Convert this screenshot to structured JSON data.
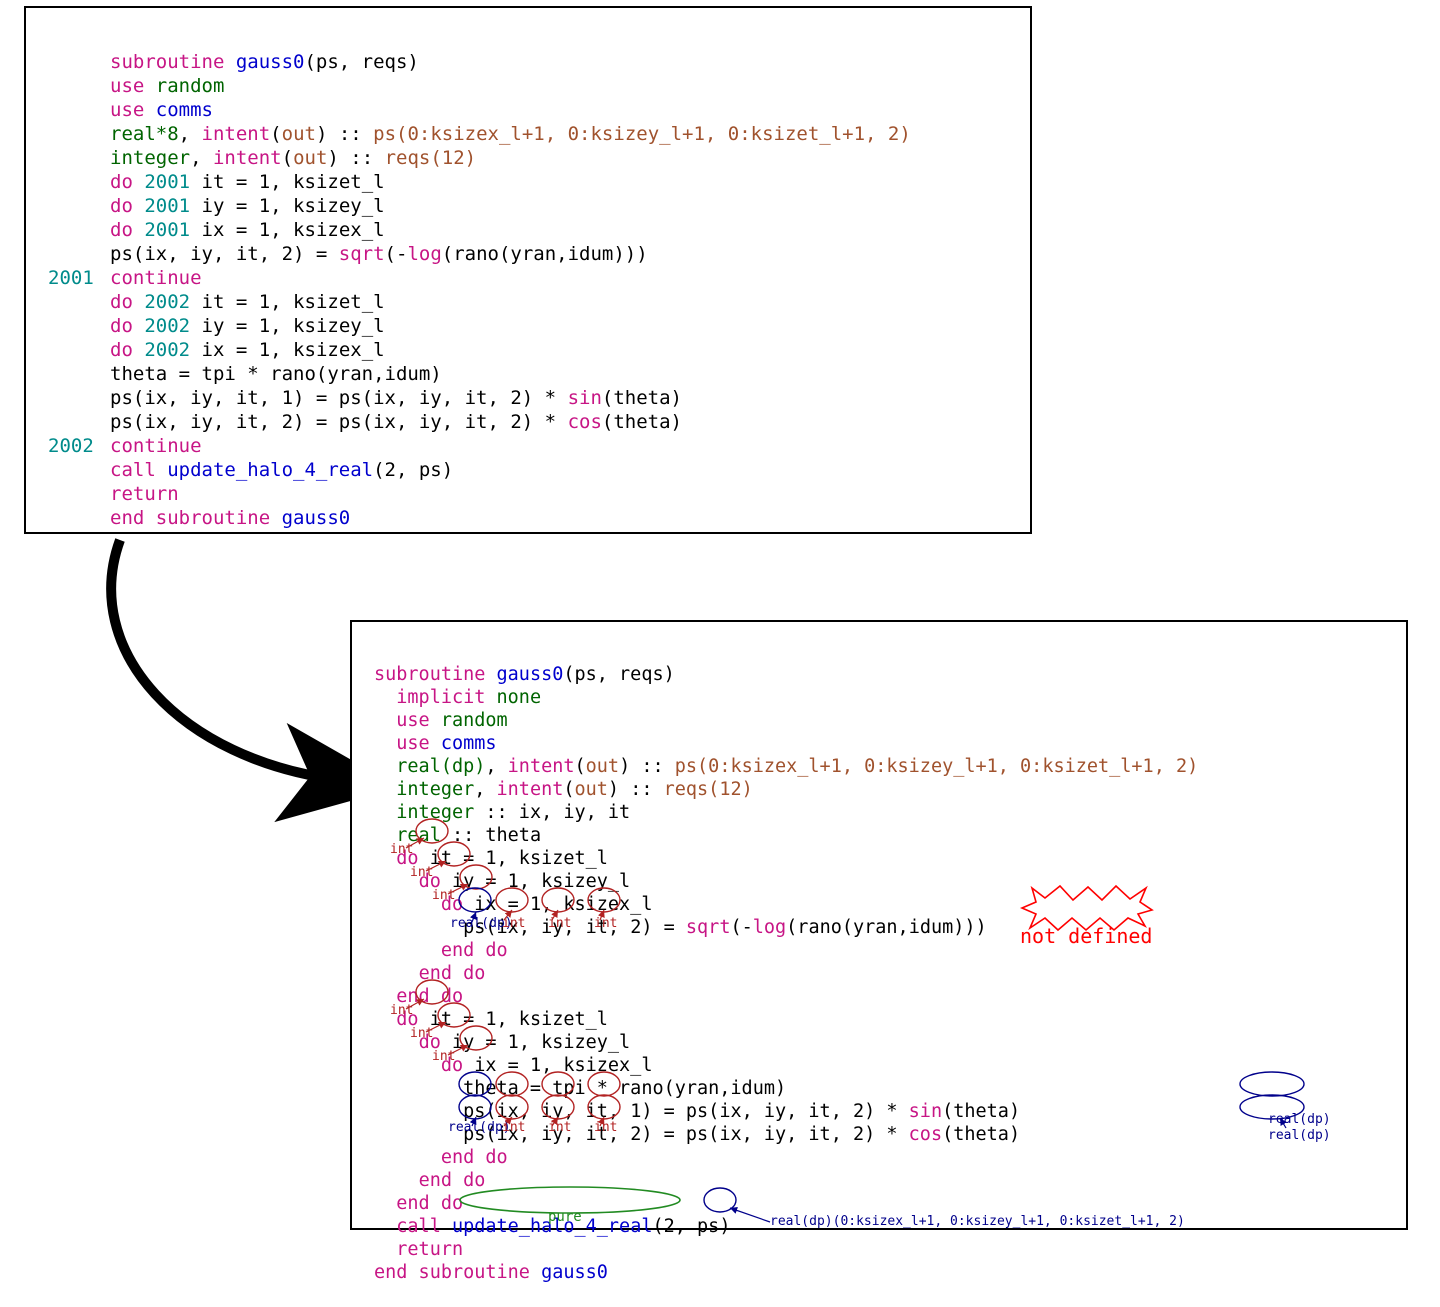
{
  "top": {
    "l1": "subroutine",
    "l1b": "gauss0",
    "l1c": "(ps, reqs)",
    "l2": "use",
    "l2b": "random",
    "l3": "use",
    "l3b": "comms",
    "l4a": "real*8",
    "l4b": ", ",
    "l4c": "intent",
    "l4d": "(",
    "l4e": "out",
    "l4f": ") :: ",
    "l4g": "ps(0:ksizex_l+1, 0:ksizey_l+1, 0:ksizet_l+1, 2)",
    "l5a": "integer",
    "l5b": ", ",
    "l5c": "intent",
    "l5d": "(",
    "l5e": "out",
    "l5f": ") :: ",
    "l5g": "reqs(12)",
    "l6a": "do",
    "l6b": "2001",
    "l6c": " it = 1, ksizet_l",
    "l7a": "do",
    "l7b": "2001",
    "l7c": " iy = 1, ksizey_l",
    "l8a": "do",
    "l8b": "2001",
    "l8c": " ix = 1, ksizex_l",
    "l9a": "ps(ix, iy, it, 2) = ",
    "l9b": "sqrt",
    "l9c": "(-",
    "l9d": "log",
    "l9e": "(rano(yran,idum)))",
    "label2001": "2001",
    "l10": "continue",
    "l11a": "do",
    "l11b": "2002",
    "l11c": " it = 1, ksizet_l",
    "l12a": "do",
    "l12b": "2002",
    "l12c": " iy = 1, ksizey_l",
    "l13a": "do",
    "l13b": "2002",
    "l13c": " ix = 1, ksizex_l",
    "l14": "theta = tpi * rano(yran,idum)",
    "l15a": "ps(ix, iy, it, 1) = ps(ix, iy, it, 2) * ",
    "l15b": "sin",
    "l15c": "(theta)",
    "l16a": "ps(ix, iy, it, 2) = ps(ix, iy, it, 2) * ",
    "l16b": "cos",
    "l16c": "(theta)",
    "label2002": "2002",
    "l17": "continue",
    "l18a": "call",
    "l18b": " update_halo_4_real",
    "l18c": "(2, ps)",
    "l19": "return",
    "l20a": "end subroutine",
    "l20b": " gauss0"
  },
  "bot": {
    "b1a": "subroutine",
    "b1b": " gauss0",
    "b1c": "(ps, reqs)",
    "b2a": "implicit",
    "b2b": " none",
    "b3a": "use",
    "b3b": " random",
    "b4a": "use",
    "b4b": " comms",
    "b5a": "real(dp)",
    "b5b": ", ",
    "b5c": "intent",
    "b5d": "(",
    "b5e": "out",
    "b5f": ") :: ",
    "b5g": "ps(0:ksizex_l+1, 0:ksizey_l+1, 0:ksizet_l+1, 2)",
    "b6a": "integer",
    "b6b": ", ",
    "b6c": "intent",
    "b6d": "(",
    "b6e": "out",
    "b6f": ") :: ",
    "b6g": "reqs(12)",
    "b7a": "integer",
    "b7b": " :: ix, iy, it",
    "b8a": "real",
    "b8b": " :: theta",
    "b9a": "do ",
    "b9b": "it",
    "b9c": " = 1, ksizet_l",
    "b10a": "do ",
    "b10b": "iy",
    "b10c": " = 1, ksizey_l",
    "b11a": "do ",
    "b11b": "ix",
    "b11c": " = 1, ksizex_l",
    "b12a": "ps",
    "b12b": "(",
    "b12c": "ix",
    "b12d": ", ",
    "b12e": "iy",
    "b12f": ", ",
    "b12g": "it",
    "b12h": ", 2) = ",
    "b12i": "sqrt",
    "b12j": "(-",
    "b12k": "log",
    "b12l": "(rano(yran,idum)))",
    "b13": "end do",
    "b14": "end do",
    "b15": "end do",
    "b16a": "do ",
    "b16b": "it",
    "b16c": " = 1, ksizet_l",
    "b17a": "do ",
    "b17b": "iy",
    "b17c": " = 1, ksizey_l",
    "b18a": "do ",
    "b18b": "ix",
    "b18c": " = 1, ksizex_l",
    "b19": "theta = tpi * rano(yran,idum)",
    "b20a": "ps",
    "b20b": "(",
    "b20c": "ix",
    "b20d": ", ",
    "b20e": "iy",
    "b20f": ", ",
    "b20g": "it",
    "b20h": ", 1) = ps(ix, iy, it, 2) * ",
    "b20i": "sin",
    "b20j": "(",
    "b20k": "theta",
    "b20l": ")",
    "b21a": "ps",
    "b21b": "(",
    "b21c": "ix",
    "b21d": ", ",
    "b21e": "iy",
    "b21f": ", ",
    "b21g": "it",
    "b21h": ", 2) = ps(ix, iy, it, 2) * ",
    "b21i": "cos",
    "b21j": "(",
    "b21k": "theta",
    "b21l": ")",
    "b22": "end do",
    "b23": "end do",
    "b24": "end do",
    "b25a": "call",
    "b25b": " update_halo_4_real",
    "b25c": "(2, ",
    "b25d": "ps",
    "b25e": ")",
    "b26": "return",
    "b27a": "end subroutine",
    "b27b": " gauss0"
  },
  "annotations": {
    "int": "int",
    "realdp": "real(dp)",
    "not_defined": "not defined",
    "pure": "pure",
    "ps_shape": "real(dp)(0:ksizex_l+1, 0:ksizey_l+1, 0:ksizet_l+1, 2)"
  }
}
